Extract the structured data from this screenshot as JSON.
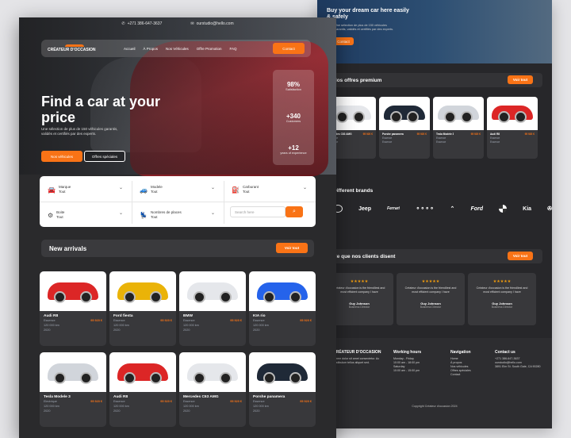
{
  "front": {
    "topbar": {
      "phone": "+271 386-647-3637",
      "email": "ourstudio@hello.com"
    },
    "nav": {
      "logo": "CRÉATEUR D'OCCASION",
      "links": [
        "Accueil",
        "À Propos",
        "Nos Véhicules",
        "Offre Promotion",
        "FAQ"
      ],
      "contact": "Contact"
    },
    "hero": {
      "title": "Find a car at your price",
      "subtitle": "Une sélection de plus de 150 véhicules garantis, validés et certifiés par des experts.",
      "btn_primary": "Nos véhicules",
      "btn_secondary": "Offres spéciales",
      "stats": [
        {
          "value": "98%",
          "label": "Satisfaction"
        },
        {
          "value": "+340",
          "label": "Customers"
        },
        {
          "value": "+12",
          "label": "years of experience"
        }
      ]
    },
    "filter": {
      "fields": [
        {
          "label": "Marque",
          "value": "Tout",
          "icon": "car-icon"
        },
        {
          "label": "Modele",
          "value": "Tout",
          "icon": "car-side-icon"
        },
        {
          "label": "Carburant",
          "value": "Tout",
          "icon": "fuel-icon"
        },
        {
          "label": "Boite",
          "value": "Tout",
          "icon": "gearbox-icon"
        },
        {
          "label": "Nombres de places",
          "value": "Tout",
          "icon": "seat-icon"
        }
      ],
      "search_placeholder": "Search here"
    },
    "new_arrivals": {
      "title": "New arrivals",
      "button": "Voir tout",
      "cars": [
        {
          "name": "Audi R8",
          "price": "95 920 €",
          "fuel": "Essence",
          "km": "120 000 km",
          "year": "2020",
          "color": "#dc2626"
        },
        {
          "name": "Ford fiesta",
          "price": "95 920 €",
          "fuel": "Essence",
          "km": "120 000 km",
          "year": "2020",
          "color": "#eab308"
        },
        {
          "name": "BMW",
          "price": "95 920 €",
          "fuel": "Essence",
          "km": "120 000 km",
          "year": "2020",
          "color": "#e5e7eb"
        },
        {
          "name": "KIA rio",
          "price": "95 920 €",
          "fuel": "Essence",
          "km": "120 000 km",
          "year": "2020",
          "color": "#2563eb"
        },
        {
          "name": "Tesla Modele 3",
          "price": "95 920 €",
          "fuel": "Electrique",
          "km": "120 000 km",
          "year": "2020",
          "color": "#d1d5db"
        },
        {
          "name": "Audi R8",
          "price": "95 920 €",
          "fuel": "Essence",
          "km": "120 000 km",
          "year": "2020",
          "color": "#dc2626"
        },
        {
          "name": "Mercedes C63 AMG",
          "price": "95 920 €",
          "fuel": "Essence",
          "km": "120 000 km",
          "year": "2020",
          "color": "#e5e7eb"
        },
        {
          "name": "Porshe panamera",
          "price": "95 920 €",
          "fuel": "Essence",
          "km": "120 000 km",
          "year": "2020",
          "color": "#1f2937"
        }
      ]
    }
  },
  "back": {
    "hero": {
      "title": "Buy your dream car here easily & safely",
      "subtitle": "Une sélection de plus de 150 véhicules garantis, validés et certifiés par des experts.",
      "button": "Contact"
    },
    "offers": {
      "title": "Nos offres premium",
      "button": "Voir tout",
      "cars": [
        {
          "name": "Mercedes C63 AMG",
          "price": "95 920 €",
          "color": "#e5e7eb"
        },
        {
          "name": "Porshe panamera",
          "price": "95 920 €",
          "color": "#1f2937"
        },
        {
          "name": "Tesla Modele 3",
          "price": "95 920 €",
          "color": "#d1d5db"
        },
        {
          "name": "Audi R8",
          "price": "95 920 €",
          "color": "#dc2626"
        }
      ],
      "detail": "Essence"
    },
    "brands": {
      "title": "Different brands",
      "items": [
        "Hyundai",
        "Jeep",
        "Ferrari",
        "Audi",
        "Citroën",
        "Ford",
        "BMW",
        "Kia",
        "Mercedes"
      ]
    },
    "testimonials": {
      "title": "Ce que nos clients disent",
      "button": "Voir tout",
      "items": [
        {
          "quote": "Créateur d'occasion is the friendliest and most efficient company I have",
          "name": "Guy Johnson",
          "role": "Business Director"
        },
        {
          "quote": "Créateur d'occasion is the friendliest and most efficient company I have",
          "name": "Guy Johnson",
          "role": "Business Director"
        },
        {
          "quote": "Créateur d'occasion is the friendliest and most efficient company I have",
          "name": "Guy Johnson",
          "role": "Business Director"
        }
      ]
    },
    "footer": {
      "logo": "CRÉATEUR D'OCCASION",
      "about": "Lorem dolor sit amet consectetur. Ac vestibulum tellus aliquet sed.",
      "hours_title": "Working hours",
      "hours": [
        "Monday - Friday",
        "10:00 am - 18:00 pm",
        "Saturday",
        "10:00 am - 15:00 pm"
      ],
      "nav_title": "Navigation",
      "nav": [
        "Home",
        "À propos",
        "Nos véhicules",
        "Offres spéciales",
        "Contact"
      ],
      "contact_title": "Contact us",
      "contact": [
        "+271 386-647-3637",
        "ourstudio@hello.com",
        "3891 Elm St. South Gate, CA 90280"
      ],
      "copyright": "Copyright Créateur d'occasion 2024"
    }
  },
  "colors": {
    "accent": "#f97316",
    "bg": "#2a2a2c",
    "card": "#38383b"
  }
}
